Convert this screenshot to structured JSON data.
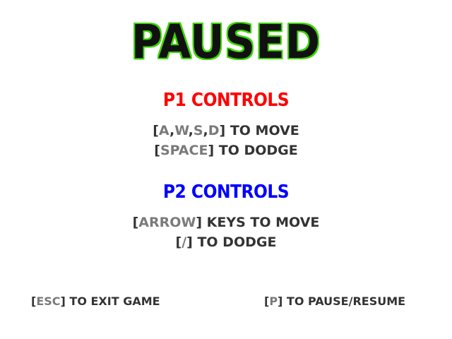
{
  "screen": {
    "title": "PAUSED",
    "title_fill_color": "#111111",
    "title_outline_color": "#3cd400",
    "bracket_text_color": "#333333",
    "key_text_color": "#7a7a7a"
  },
  "p1": {
    "heading": "P1 CONTROLS",
    "heading_color": "#ff0000",
    "move_keys": [
      "A",
      "W",
      "S",
      "D"
    ],
    "move_suffix": " TO MOVE",
    "dodge_key": "SPACE",
    "dodge_suffix": " TO DODGE"
  },
  "p2": {
    "heading": "P2 CONTROLS",
    "heading_color": "#0000ff",
    "move_key": "ARROW",
    "move_suffix": " KEYS TO MOVE",
    "dodge_key": "/",
    "dodge_suffix": " TO DODGE"
  },
  "footer": {
    "exit_key": "ESC",
    "exit_suffix": " TO EXIT GAME",
    "pause_key": "P",
    "pause_suffix": " TO PAUSE/RESUME"
  }
}
